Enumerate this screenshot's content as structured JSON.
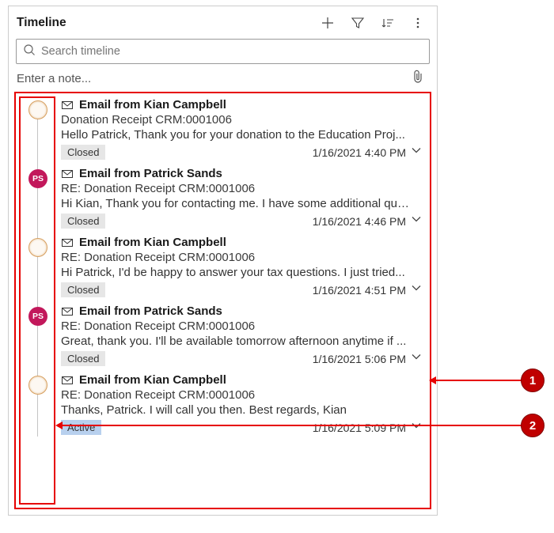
{
  "header": {
    "title": "Timeline"
  },
  "search": {
    "placeholder": "Search timeline"
  },
  "note": {
    "placeholder": "Enter a note..."
  },
  "items": [
    {
      "avatar_type": "kian",
      "avatar_text": "",
      "title": "Email from Kian Campbell",
      "subject": "Donation Receipt CRM:0001006",
      "preview": "Hello Patrick,   Thank you for your donation to the Education Proj...",
      "status": "Closed",
      "status_class": "closed",
      "timestamp": "1/16/2021 4:40 PM"
    },
    {
      "avatar_type": "ps",
      "avatar_text": "PS",
      "title": "Email from Patrick Sands",
      "subject": "RE: Donation Receipt CRM:0001006",
      "preview": "Hi Kian, Thank you for contacting me. I have some additional que...",
      "status": "Closed",
      "status_class": "closed",
      "timestamp": "1/16/2021 4:46 PM"
    },
    {
      "avatar_type": "kian",
      "avatar_text": "",
      "title": "Email from Kian Campbell",
      "subject": "RE: Donation Receipt CRM:0001006",
      "preview": "Hi Patrick,   I'd be happy to answer your tax questions. I just tried...",
      "status": "Closed",
      "status_class": "closed",
      "timestamp": "1/16/2021 4:51 PM"
    },
    {
      "avatar_type": "ps",
      "avatar_text": "PS",
      "title": "Email from Patrick Sands",
      "subject": "RE: Donation Receipt CRM:0001006",
      "preview": "Great, thank you. I'll be available tomorrow afternoon anytime if ...",
      "status": "Closed",
      "status_class": "closed",
      "timestamp": "1/16/2021 5:06 PM"
    },
    {
      "avatar_type": "kian",
      "avatar_text": "",
      "title": "Email from Kian Campbell",
      "subject": "RE: Donation Receipt CRM:0001006",
      "preview": "Thanks, Patrick. I will call you then.   Best regards, Kian",
      "status": "Active",
      "status_class": "active",
      "timestamp": "1/16/2021 5:09 PM"
    }
  ],
  "callouts": {
    "c1": "1",
    "c2": "2"
  }
}
